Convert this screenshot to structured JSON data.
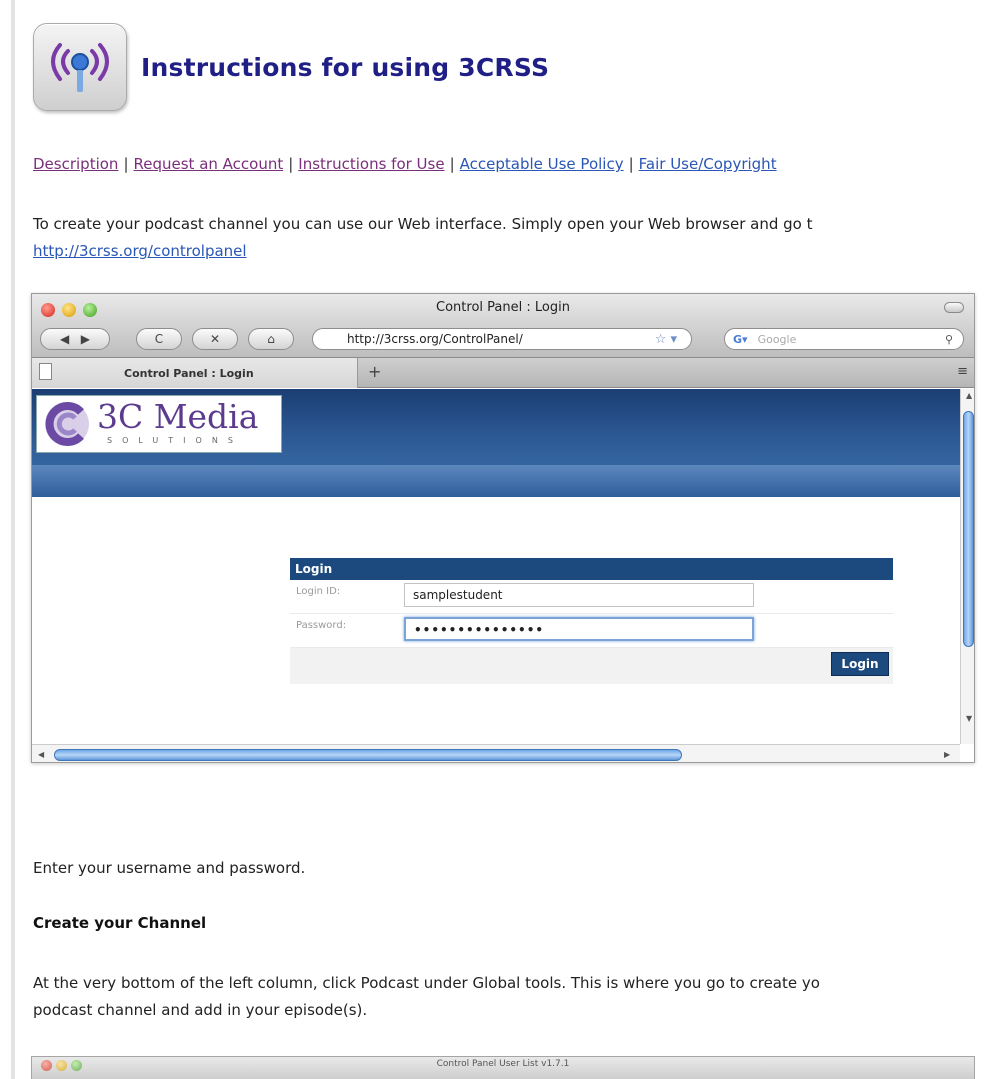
{
  "header": {
    "title": "Instructions for using 3CRSS",
    "icon": "podcast-antenna-icon"
  },
  "nav": {
    "links": [
      {
        "label": "Description",
        "state": "visited"
      },
      {
        "label": "Request an Account",
        "state": "visited"
      },
      {
        "label": "Instructions for Use",
        "state": "visited"
      },
      {
        "label": "Acceptable Use Policy",
        "state": "unvisited"
      },
      {
        "label": "Fair Use/Copyright",
        "state": "unvisited"
      }
    ],
    "separator": "|"
  },
  "intro": {
    "text": "To create your podcast channel you can use our Web interface. Simply open your Web browser and go t",
    "link": "http://3crss.org/controlpanel"
  },
  "screenshot": {
    "window_title": "Control Panel : Login",
    "url": "http://3crss.org/ControlPanel/",
    "search_placeholder": "Google",
    "tab_label": "Control Panel : Login",
    "new_tab": "+",
    "logo": {
      "text": "3C Media",
      "subtext": "SOLUTIONS"
    },
    "login": {
      "header": "Login",
      "id_label": "Login ID:",
      "id_value": "samplestudent",
      "password_label": "Password:",
      "password_value": "•••••••••••••••",
      "button": "Login"
    }
  },
  "body": {
    "step1": "Enter your username and password.",
    "subhead": "Create your Channel",
    "step2_line1": "At the very bottom of the left column, click Podcast under Global tools. This is where you go to create yo",
    "step2_line2": "podcast channel and add in your episode(s)."
  },
  "screenshot2": {
    "window_title": "Control Panel   User List v1.7.1"
  },
  "colors": {
    "title": "#1f1f86",
    "visited": "#7a2f7a",
    "link": "#2a56b5",
    "banner": "#1b3e73"
  }
}
